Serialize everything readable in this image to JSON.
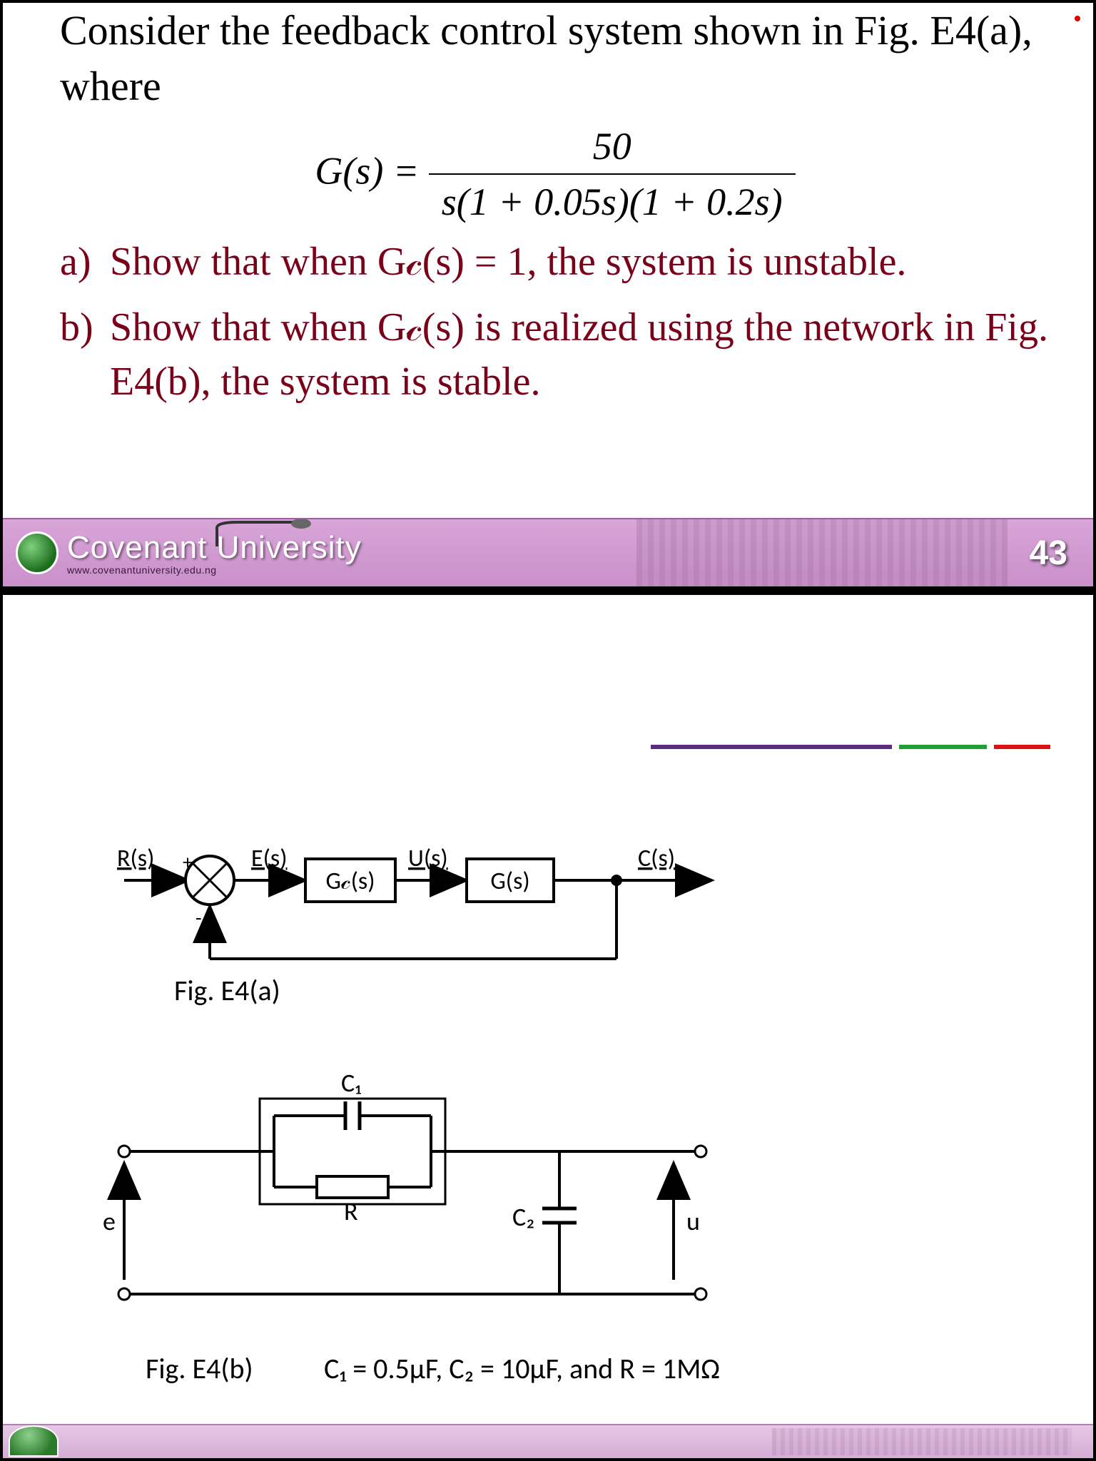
{
  "slide1": {
    "intro": "Consider the feedback control system shown in Fig. E4(a), where",
    "eq_lhs": "G(s) =",
    "eq_num": "50",
    "eq_den": "s(1 + 0.05s)(1 + 0.2s)",
    "part_a_label": "a)",
    "part_a_text": "Show that when G𝒸(s) = 1, the system is unstable.",
    "part_b_label": "b)",
    "part_b_text": "Show that when G𝒸(s) is realized using the network in Fig. E4(b), the system is stable.",
    "university": "Covenant University",
    "uni_url": "www.covenantuniversity.edu.ng",
    "page_num": "43"
  },
  "diagram_a": {
    "R": "R(s)",
    "plus": "+",
    "minus": "-",
    "E": "E(s)",
    "Gc": "G𝒸(s)",
    "U": "U(s)",
    "G": "G(s)",
    "C": "C(s)",
    "caption": "Fig. E4(a)"
  },
  "diagram_b": {
    "e": "e",
    "u": "u",
    "C1": "C₁",
    "R": "R",
    "C2": "C₂",
    "caption": "Fig. E4(b)",
    "values": "C₁ = 0.5µF, C₂ = 10µF, and R = 1MΩ"
  }
}
